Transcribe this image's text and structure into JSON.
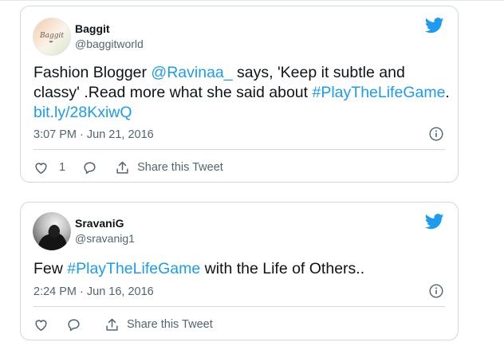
{
  "tweets": [
    {
      "user": {
        "name": "Baggit",
        "handle": "@baggitworld",
        "avatar_text": "Baggit"
      },
      "text_parts": [
        "Fashion Blogger ",
        "@Ravinaa_",
        " says, 'Keep it subtle and classy' .Read more what she said about ",
        "#PlayTheLifeGame",
        ". ",
        "bit.ly/28KxiwQ"
      ],
      "timestamp": "3:07 PM · Jun 21, 2016",
      "likes": "1",
      "share_label": "Share this Tweet"
    },
    {
      "user": {
        "name": "SravaniG",
        "handle": "@sravanig1"
      },
      "text_parts": [
        "Few ",
        "#PlayTheLifeGame",
        " with the Life of Others.."
      ],
      "timestamp": "2:24 PM · Jun 16, 2016",
      "likes": "",
      "share_label": "Share this Tweet"
    }
  ],
  "colors": {
    "link": "#1d9bf0",
    "text": "#0f1419",
    "secondary": "#536471",
    "border": "#cfd9de"
  },
  "icons": [
    "twitter-bird-icon",
    "info-icon",
    "heart-icon",
    "reply-icon",
    "share-icon"
  ]
}
